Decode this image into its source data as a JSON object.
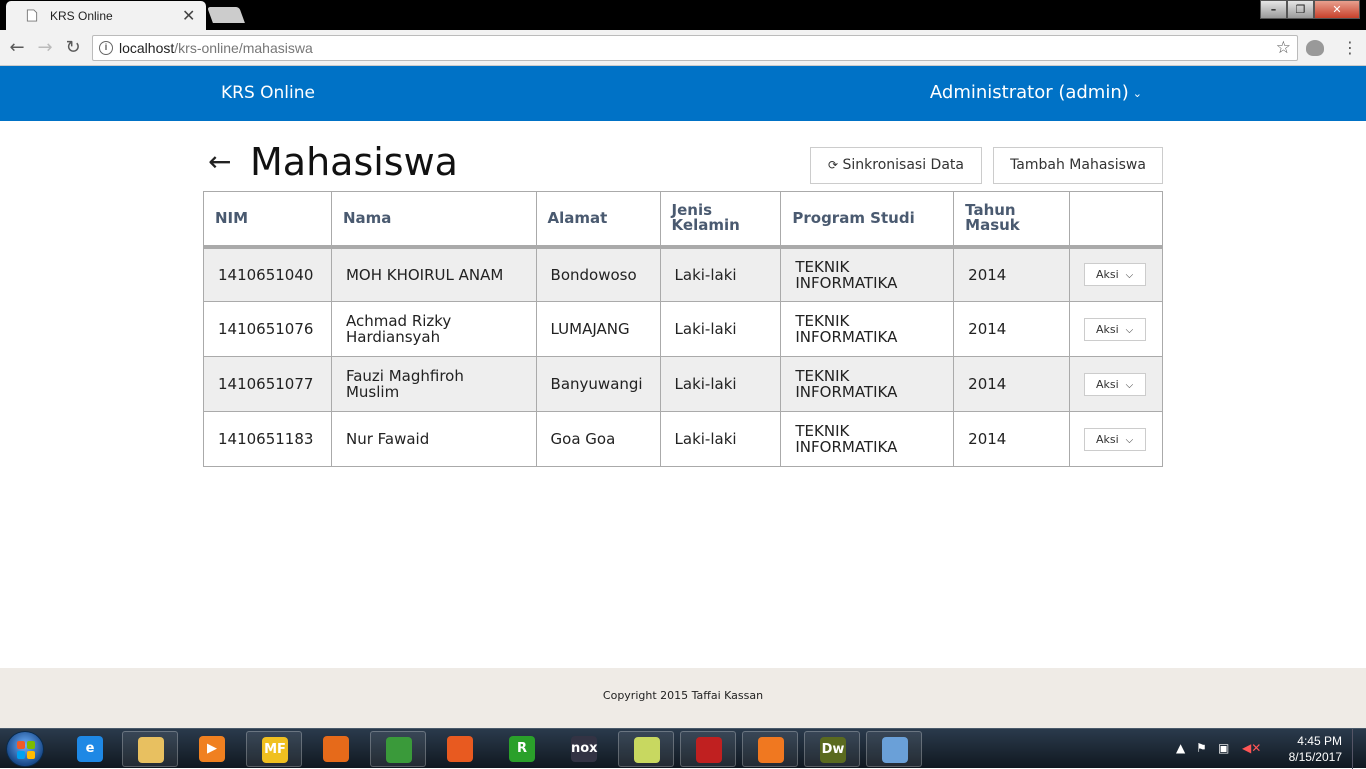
{
  "browser": {
    "tab_title": "KRS Online",
    "tab_close": "✕",
    "url_host": "localhost",
    "url_path": "/krs-online/mahasiswa",
    "window_buttons": [
      "–",
      "❐",
      "✕"
    ]
  },
  "navbar": {
    "brand": "KRS Online",
    "user": "Administrator (admin)"
  },
  "page": {
    "back_glyph": "←",
    "title": "Mahasiswa",
    "sync_button": "Sinkronisasi Data",
    "add_button": "Tambah Mahasiswa"
  },
  "table": {
    "headers": [
      "NIM",
      "Nama",
      "Alamat",
      "Jenis Kelamin",
      "Program Studi",
      "Tahun Masuk",
      ""
    ],
    "rows": [
      {
        "nim": "1410651040",
        "nama": "MOH KHOIRUL ANAM",
        "alamat": "Bondowoso",
        "jk": "Laki-laki",
        "prodi": "TEKNIK INFORMATIKA",
        "tahun": "2014",
        "aksi": "Aksi"
      },
      {
        "nim": "1410651076",
        "nama": "Achmad Rizky Hardiansyah",
        "alamat": "LUMAJANG",
        "jk": "Laki-laki",
        "prodi": "TEKNIK INFORMATIKA",
        "tahun": "2014",
        "aksi": "Aksi"
      },
      {
        "nim": "1410651077",
        "nama": "Fauzi Maghfiroh Muslim",
        "alamat": "Banyuwangi",
        "jk": "Laki-laki",
        "prodi": "TEKNIK INFORMATIKA",
        "tahun": "2014",
        "aksi": "Aksi"
      },
      {
        "nim": "1410651183",
        "nama": "Nur Fawaid",
        "alamat": "Goa Goa",
        "jk": "Laki-laki",
        "prodi": "TEKNIK INFORMATIKA",
        "tahun": "2014",
        "aksi": "Aksi"
      }
    ]
  },
  "footer": {
    "copyright": "Copyright 2015 Taffai Kassan"
  },
  "taskbar": {
    "apps": [
      {
        "name": "internet-explorer",
        "label": "e",
        "color": "#1e88e5"
      },
      {
        "name": "file-explorer",
        "label": "",
        "color": "#e8c060"
      },
      {
        "name": "media-player",
        "label": "▶",
        "color": "#f08020"
      },
      {
        "name": "mediafire",
        "label": "MF",
        "color": "#f0c020"
      },
      {
        "name": "firefox",
        "label": "",
        "color": "#e66a1a"
      },
      {
        "name": "chrome",
        "label": "",
        "color": "#3a9a3a"
      },
      {
        "name": "openvpn",
        "label": "",
        "color": "#e85a20"
      },
      {
        "name": "r-app",
        "label": "R",
        "color": "#2aa02a"
      },
      {
        "name": "nox",
        "label": "nox",
        "color": "#334"
      },
      {
        "name": "sticky-notes",
        "label": "",
        "color": "#c8d860"
      },
      {
        "name": "filezilla",
        "label": "",
        "color": "#c02020"
      },
      {
        "name": "xampp",
        "label": "",
        "color": "#f07820"
      },
      {
        "name": "dreamweaver",
        "label": "Dw",
        "color": "#5a6a20"
      },
      {
        "name": "paint",
        "label": "",
        "color": "#6aa0d8"
      }
    ],
    "time": "4:45 PM",
    "date": "8/15/2017"
  }
}
